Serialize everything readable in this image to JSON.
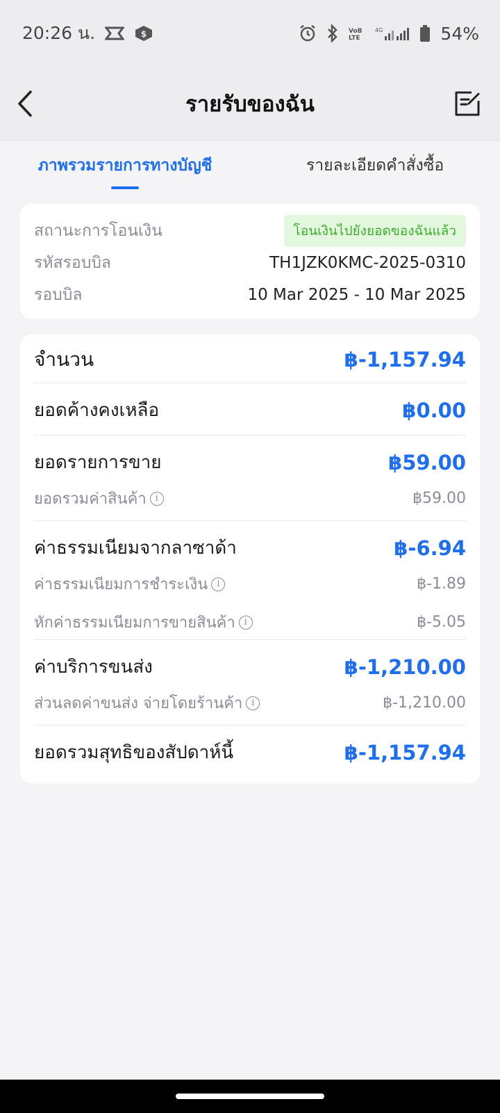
{
  "status_bar": {
    "time": "20:26 น.",
    "battery": "54%"
  },
  "header": {
    "title": "รายรับของฉัน"
  },
  "tabs": [
    {
      "label": "ภาพรวมรายการทางบัญชี",
      "active": true
    },
    {
      "label": "รายละเอียดคำสั่งซื้อ",
      "active": false
    }
  ],
  "info": {
    "status_label": "สถานะการโอนเงิน",
    "status_badge": "โอนเงินไปยังยอดของฉันแล้ว",
    "bill_code_label": "รหัสรอบบิล",
    "bill_code": "TH1JZK0KMC-2025-0310",
    "bill_cycle_label": "รอบบิล",
    "bill_cycle": "10 Mar 2025 - 10 Mar 2025"
  },
  "amount": {
    "total_label": "จำนวน",
    "total_value": "฿-1,157.94",
    "outstanding_label": "ยอดค้างคงเหลือ",
    "outstanding_value": "฿0.00",
    "sales_label": "ยอดรายการขาย",
    "sales_value": "฿59.00",
    "product_total_label": "ยอดรวมค่าสินค้า",
    "product_total_value": "฿59.00",
    "lazada_fee_label": "ค่าธรรมเนียมจากลาซาด้า",
    "lazada_fee_value": "฿-6.94",
    "payment_fee_label": "ค่าธรรมเนียมการชำระเงิน",
    "payment_fee_value": "฿-1.89",
    "selling_fee_label": "หักค่าธรรมเนียมการขายสินค้า",
    "selling_fee_value": "฿-5.05",
    "shipping_label": "ค่าบริการขนส่ง",
    "shipping_value": "฿-1,210.00",
    "shipping_discount_label": "ส่วนลดค่าขนส่ง จ่ายโดยร้านค้า",
    "shipping_discount_value": "฿-1,210.00",
    "weekly_net_label": "ยอดรวมสุทธิของสัปดาห์นี้",
    "weekly_net_value": "฿-1,157.94"
  },
  "colors": {
    "accent": "#1e6ef0",
    "badge_bg": "#e3f7df",
    "badge_text": "#3eae2c"
  }
}
